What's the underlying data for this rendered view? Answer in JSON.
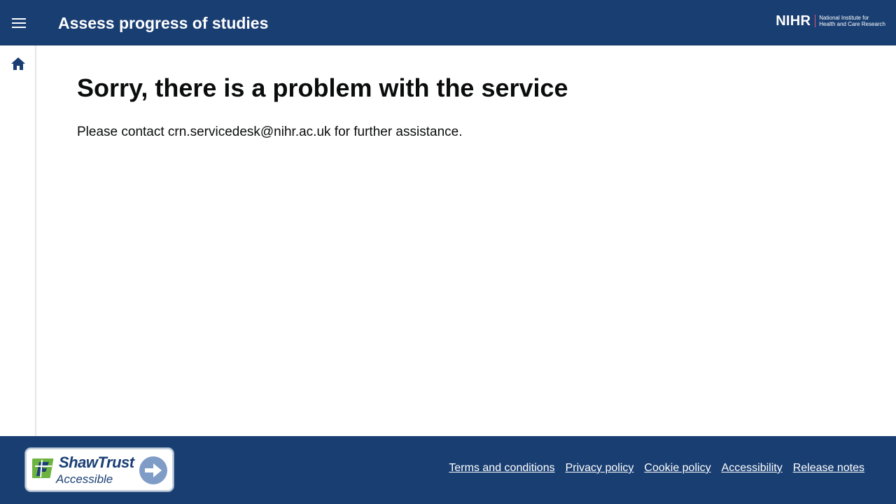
{
  "header": {
    "title": "Assess progress of studies",
    "menu_icon": "hamburger-menu-icon",
    "logo": {
      "mark": "NIHR",
      "line1": "National Institute for",
      "line2": "Health and Care Research"
    }
  },
  "sidenav": {
    "home_icon": "home-icon"
  },
  "main": {
    "title": "Sorry, there is a problem with the service",
    "message": "Please contact crn.servicedesk@nihr.ac.uk for further assistance."
  },
  "footer": {
    "badge": {
      "name": "ShawTrust",
      "sub": "Accessible"
    },
    "links": [
      {
        "label": "Terms and conditions"
      },
      {
        "label": "Privacy policy"
      },
      {
        "label": "Cookie policy"
      },
      {
        "label": "Accessibility"
      },
      {
        "label": "Release notes"
      }
    ]
  },
  "colors": {
    "brand_navy": "#193e72",
    "text": "#0b0c0c",
    "nihr_divider": "#e05a74"
  }
}
